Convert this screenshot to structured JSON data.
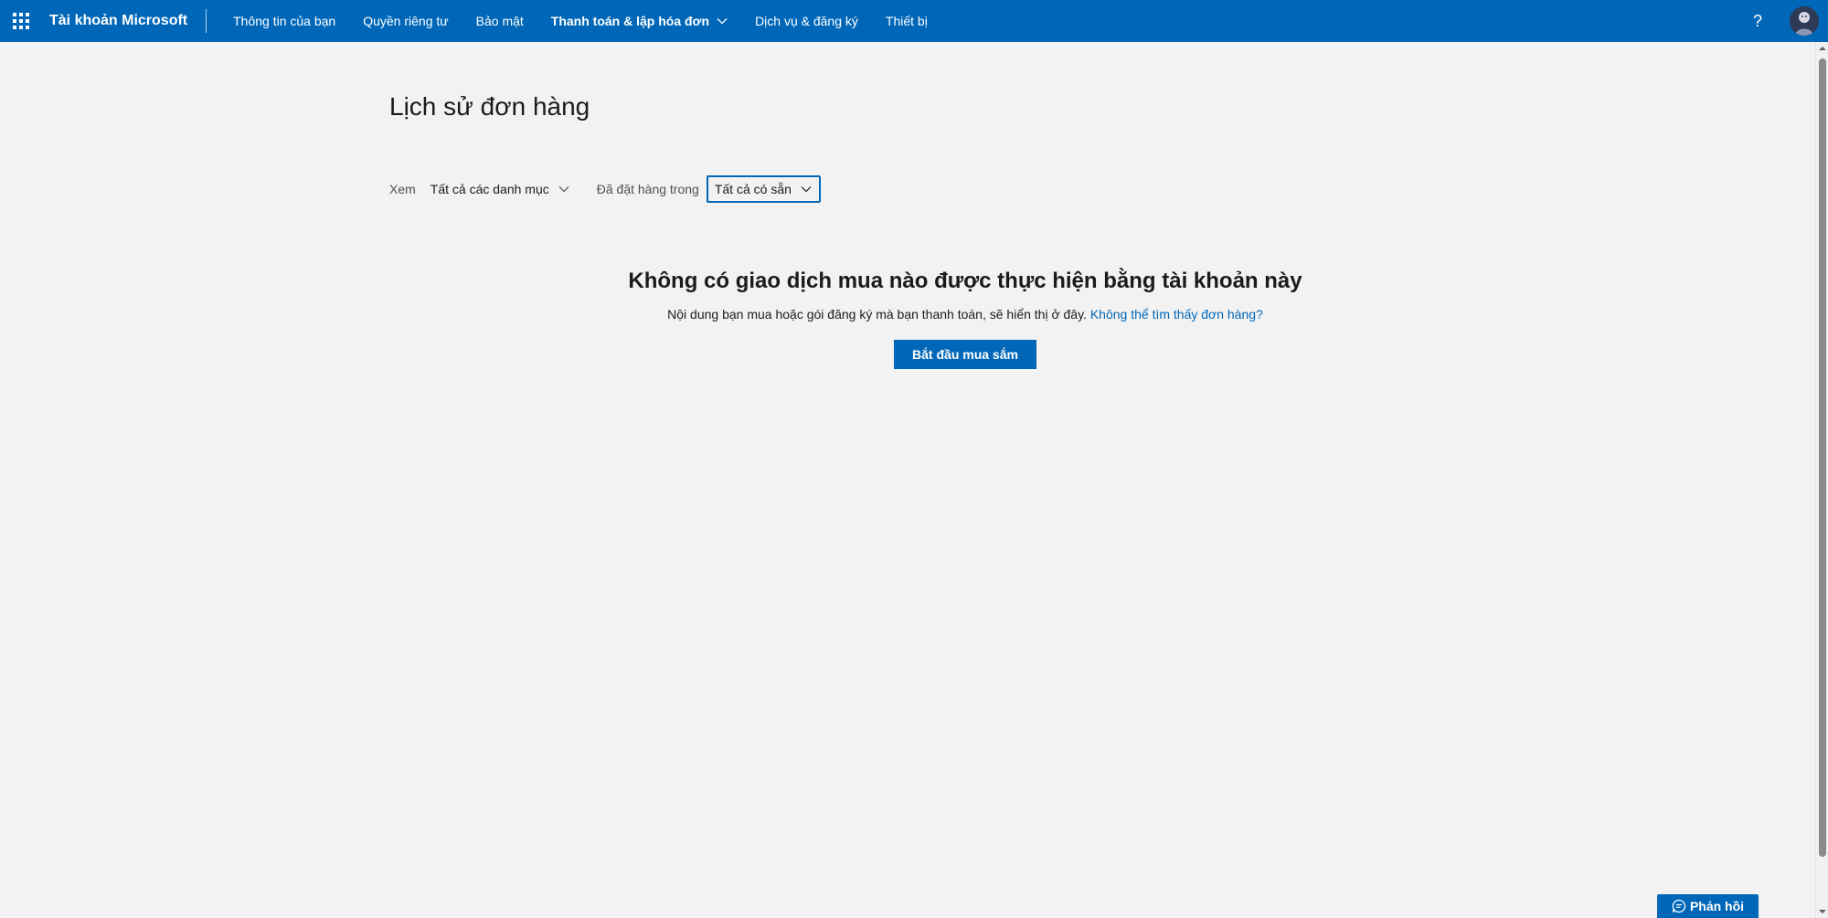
{
  "header": {
    "brand": "Tài khoản Microsoft",
    "nav": [
      {
        "label": "Thông tin của bạn"
      },
      {
        "label": "Quyền riêng tư"
      },
      {
        "label": "Bảo mật"
      },
      {
        "label": "Thanh toán & lập hóa đơn"
      },
      {
        "label": "Dịch vụ & đăng ký"
      },
      {
        "label": "Thiết bị"
      }
    ],
    "help": "?"
  },
  "page": {
    "title": "Lịch sử đơn hàng"
  },
  "filters": {
    "view_label": "Xem",
    "view_value": "Tất cả các danh mục",
    "ordered_label": "Đã đặt hàng trong",
    "ordered_value": "Tất cả có sẵn"
  },
  "empty_state": {
    "title": "Không có giao dịch mua nào được thực hiện bằng tài khoản này",
    "description": "Nội dung bạn mua hoặc gói đăng ký mà bạn thanh toán, sẽ hiển thị ở đây.",
    "link": "Không thể tìm thấy đơn hàng?",
    "button": "Bắt đầu mua sắm"
  },
  "feedback": {
    "label": "Phản hồi"
  },
  "colors": {
    "brand": "#0067b8",
    "background": "#f2f2f2"
  }
}
